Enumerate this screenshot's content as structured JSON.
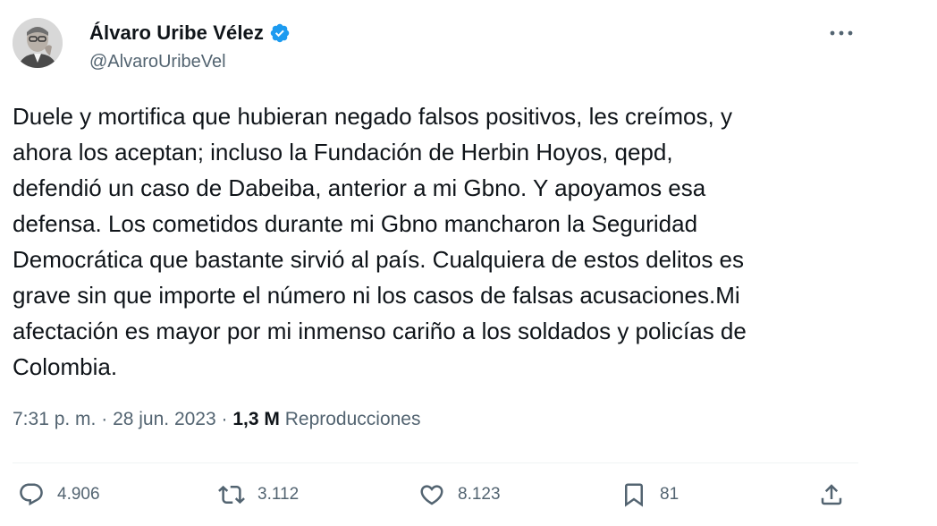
{
  "author": {
    "display_name": "Álvaro Uribe Vélez",
    "handle": "@AlvaroUribeVel",
    "verified": true,
    "verified_color": "#1d9bf0"
  },
  "tweet": {
    "text": "Duele y mortifica que hubieran negado falsos positivos, les creímos, y\nahora los aceptan; incluso la Fundación de Herbin Hoyos, qepd,\ndefendió un caso de Dabeiba, anterior a mi Gbno. Y apoyamos esa\ndefensa. Los cometidos durante mi Gbno mancharon la Seguridad\nDemocrática que bastante sirvió al país. Cualquiera de estos delitos es\ngrave sin que importe el número ni los casos de falsas acusaciones.Mi\nafectación es mayor por mi inmenso cariño a los soldados y policías de\nColombia.",
    "time": "7:31 p. m.",
    "separator": " · ",
    "date": "28 jun. 2023",
    "views_count": "1,3 M",
    "views_label": "Reproducciones"
  },
  "actions": {
    "replies": "4.906",
    "retweets": "3.112",
    "likes": "8.123",
    "bookmarks": "81"
  },
  "icons": {
    "avatar": "avatar-photo",
    "verified": "verified-badge-icon",
    "more": "more-options-icon",
    "reply": "reply-icon",
    "retweet": "retweet-icon",
    "like": "heart-icon",
    "bookmark": "bookmark-icon",
    "share": "share-icon"
  },
  "colors": {
    "text_primary": "#0f1419",
    "text_secondary": "#536471",
    "divider": "#eff3f4"
  }
}
